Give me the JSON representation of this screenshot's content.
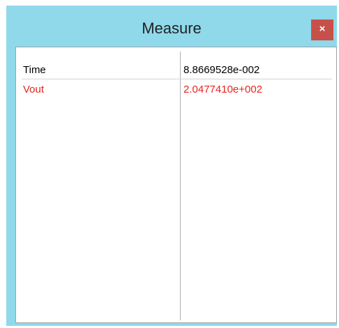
{
  "window": {
    "title": "Measure",
    "close_label": "×",
    "background_color": "#8fd9ea",
    "close_color": "#c7504b"
  },
  "measurements": [
    {
      "name": "Time",
      "value": "8.8669528e-002",
      "color": "#000000"
    },
    {
      "name": "Vout",
      "value": "2.0477410e+002",
      "color": "#e8231f"
    }
  ]
}
